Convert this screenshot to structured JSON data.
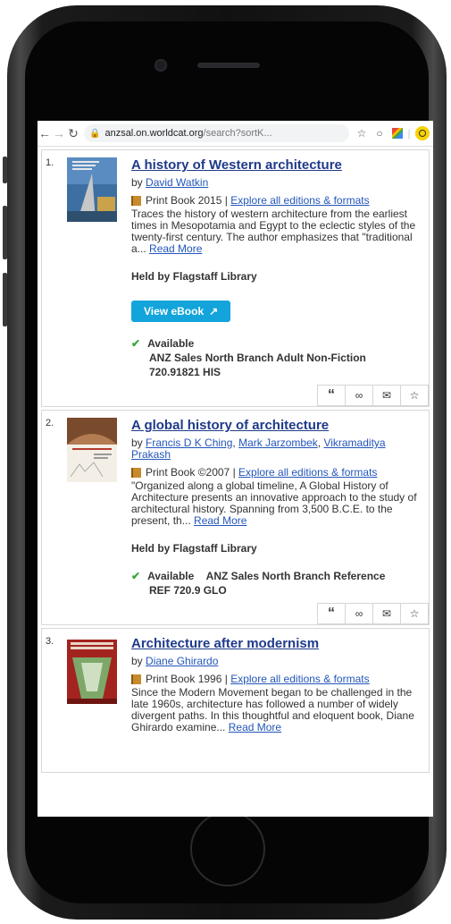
{
  "browser": {
    "url_host": "anzsal.on.worldcat.org",
    "url_path": "/search?sortK..."
  },
  "results": [
    {
      "num": "1.",
      "title": "A history of Western architecture",
      "by_prefix": "by",
      "authors": [
        "David Watkin"
      ],
      "format": "Print Book 2015 | ",
      "editions_link": "Explore all editions & formats",
      "desc": "Traces the history of western architecture from the earliest times in Mesopotamia and Egypt to the eclectic styles of the twenty-first century. The author emphasizes that \"traditional a...",
      "read_more": "Read More",
      "held": "Held by Flagstaff Library",
      "ebook_label": "View eBook",
      "availability": "Available",
      "location": "ANZ Sales North Branch Adult Non-Fiction",
      "callno": "720.91821 HIS"
    },
    {
      "num": "2.",
      "title": "A global history of architecture",
      "by_prefix": "by",
      "authors": [
        "Francis D K Ching",
        "Mark Jarzombek",
        "Vikramaditya Prakash"
      ],
      "format": "Print Book ©2007 | ",
      "editions_link": "Explore all editions & formats",
      "desc": "\"Organized along a global timeline, A Global History of Architecture presents an innovative approach to the study of architectural history. Spanning from 3,500 B.C.E. to the present, th...",
      "read_more": "Read More",
      "held": "Held by Flagstaff Library",
      "availability": "Available",
      "location": "ANZ Sales North Branch Reference",
      "callno": "REF 720.9 GLO"
    },
    {
      "num": "3.",
      "title": "Architecture after modernism",
      "by_prefix": "by",
      "authors": [
        "Diane Ghirardo"
      ],
      "format": "Print Book 1996 | ",
      "editions_link": "Explore all editions & formats",
      "desc": "Since the Modern Movement began to be challenged in the late 1960s, architecture has followed a number of widely divergent paths. In this thoughtful and eloquent book, Diane Ghirardo examine...",
      "read_more": "Read More"
    }
  ],
  "icons": {
    "cite": "“",
    "link": "∞",
    "email": "✉",
    "star": "☆",
    "external": "↗",
    "check": "✔"
  },
  "colors": {
    "link": "#2356b8",
    "ebook_button": "#12a4db",
    "available_check": "#3aa63a"
  }
}
